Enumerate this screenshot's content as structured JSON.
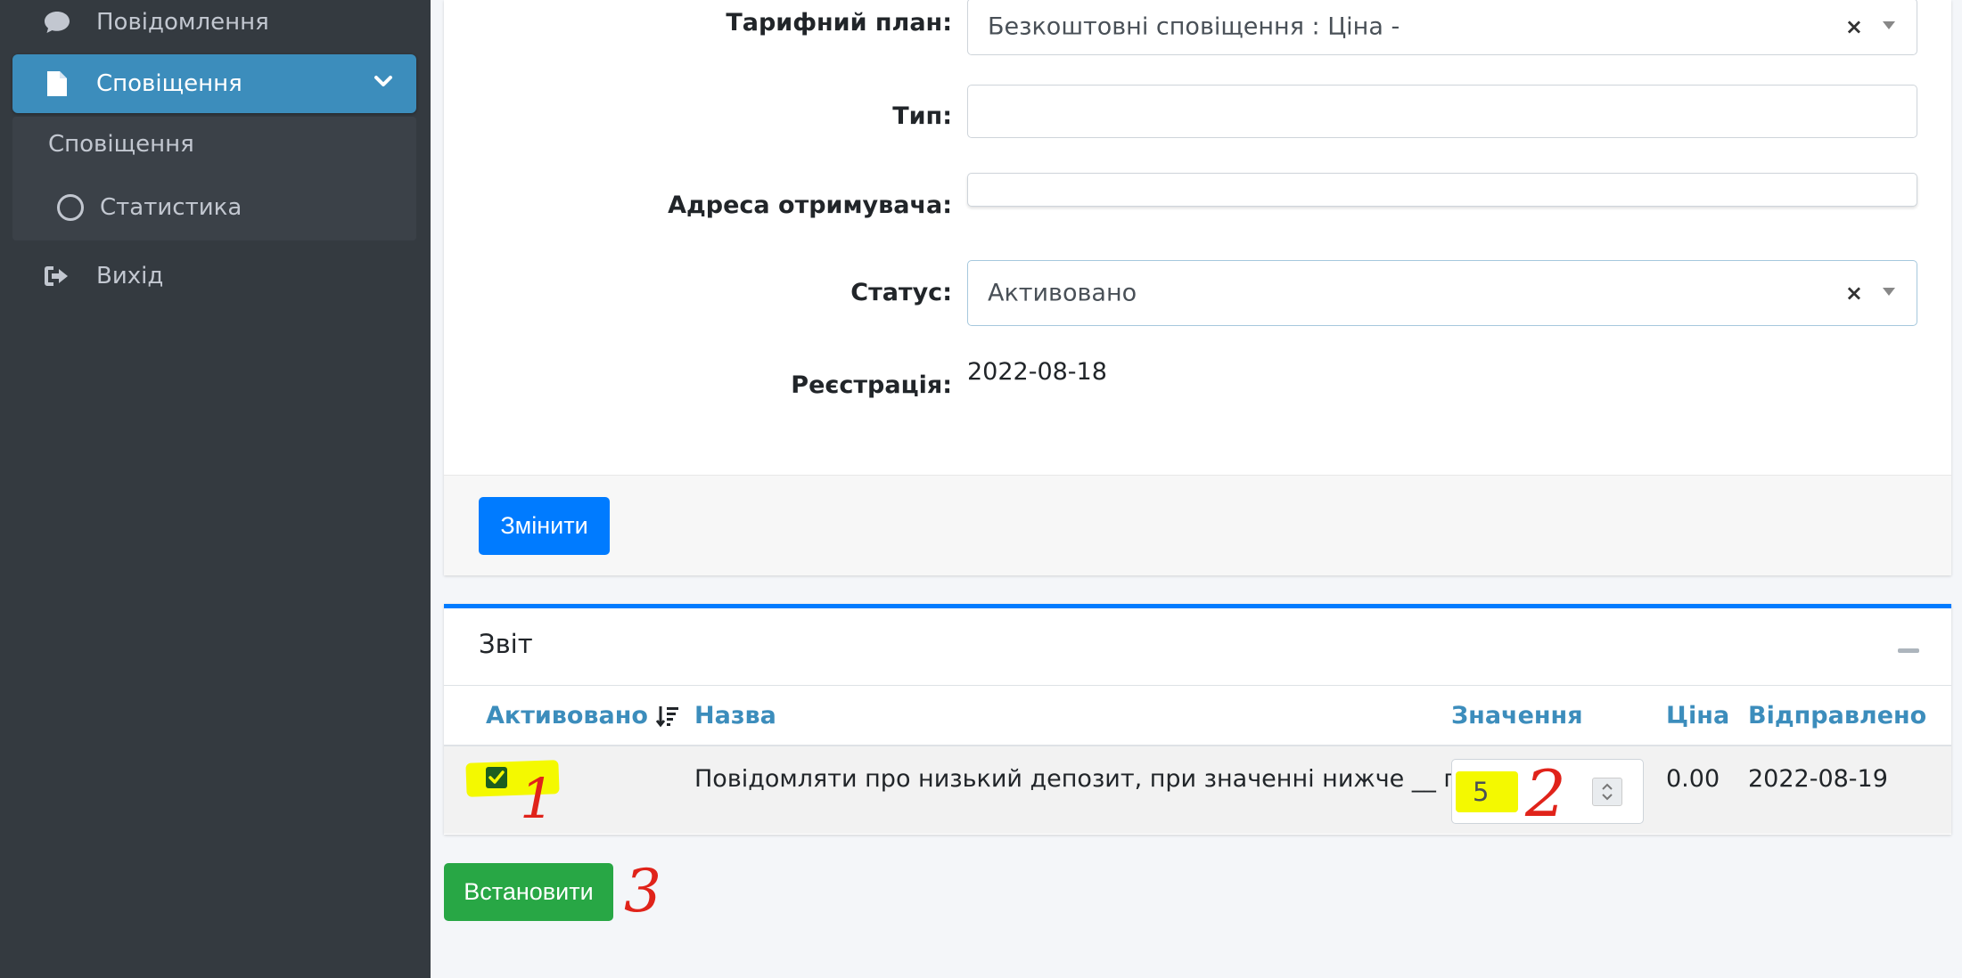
{
  "sidebar": {
    "items": [
      {
        "label": "Повідомлення",
        "icon": "comment-icon"
      },
      {
        "label": "Сповіщення",
        "icon": "file-icon",
        "active": true
      },
      {
        "label": "Вихід",
        "icon": "sign-out-icon"
      }
    ],
    "submenu": [
      {
        "label": "Сповіщення"
      },
      {
        "label": "Статистика",
        "icon": "circle-icon"
      }
    ]
  },
  "form": {
    "tariff": {
      "label": "Тарифний план:",
      "value": "Безкоштовні сповіщення : Ціна -",
      "clear": "×"
    },
    "type": {
      "label": "Тип:",
      "value": ""
    },
    "address": {
      "label": "Адреса отримувача:",
      "value": ""
    },
    "status": {
      "label": "Статус:",
      "value": "Активовано",
      "clear": "×"
    },
    "registration": {
      "label": "Реєстрація:",
      "value": "2022-08-18"
    }
  },
  "buttons": {
    "change": "Змінити",
    "set": "Встановити"
  },
  "report": {
    "title": "Звіт",
    "columns": [
      "Активовано",
      "Назва",
      "Значення",
      "Ціна",
      "Відправлено"
    ],
    "rows": [
      {
        "activated": true,
        "name": "Повідомляти про низький депозит, при значенні нижче __ грн",
        "value": "5",
        "price": "0.00",
        "sent": "2022-08-19"
      }
    ]
  },
  "annotations": {
    "one": "1",
    "two": "2",
    "three": "3"
  },
  "colors": {
    "sidebar_bg": "#343a40",
    "active_item": "#3c8dbc",
    "primary": "#007bff",
    "success": "#28a745",
    "link_header": "#3c8dbc",
    "highlight": "#f4f900",
    "annotation": "#e0231a"
  }
}
